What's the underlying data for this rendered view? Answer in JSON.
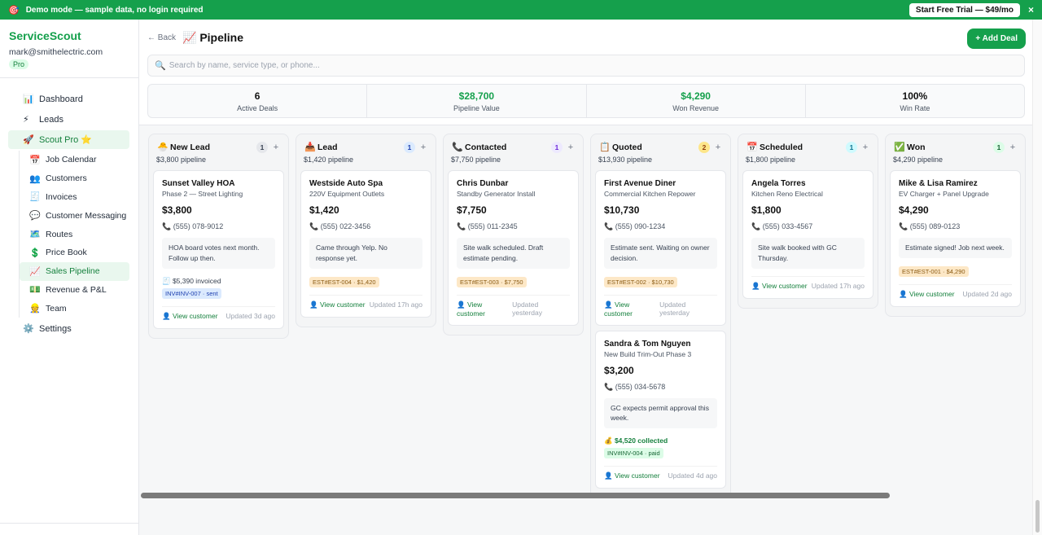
{
  "banner": {
    "icon": "🎯",
    "text": "Demo mode — sample data, no login required",
    "trial_label": "Start Free Trial — $49/mo",
    "close": "×"
  },
  "sidebar": {
    "brand": "ServiceScout",
    "email": "mark@smithelectric.com",
    "plan": "Pro",
    "items": [
      {
        "icon": "📊",
        "label": "Dashboard"
      },
      {
        "icon": "⚡",
        "label": "Leads"
      },
      {
        "icon": "🚀",
        "label": "Scout Pro ⭐"
      }
    ],
    "subitems": [
      {
        "icon": "📅",
        "label": "Job Calendar"
      },
      {
        "icon": "👥",
        "label": "Customers"
      },
      {
        "icon": "🧾",
        "label": "Invoices"
      },
      {
        "icon": "💬",
        "label": "Customer Messaging"
      },
      {
        "icon": "🗺️",
        "label": "Routes"
      },
      {
        "icon": "💲",
        "label": "Price Book"
      },
      {
        "icon": "📈",
        "label": "Sales Pipeline"
      },
      {
        "icon": "💵",
        "label": "Revenue & P&L"
      },
      {
        "icon": "👷",
        "label": "Team"
      }
    ],
    "settings": {
      "icon": "⚙️",
      "label": "Settings"
    }
  },
  "header": {
    "back": "← Back",
    "title": "📈 Pipeline",
    "add_label": "+ Add Deal",
    "search_icon": "🔍",
    "search_placeholder": "Search by name, service type, or phone..."
  },
  "stats": [
    {
      "value": "6",
      "label": "Active Deals",
      "color": "#111111"
    },
    {
      "value": "$28,700",
      "label": "Pipeline Value",
      "color": "#15a04c"
    },
    {
      "value": "$4,290",
      "label": "Won Revenue",
      "color": "#15a04c"
    },
    {
      "value": "100%",
      "label": "Win Rate",
      "color": "#111111"
    }
  ],
  "columns": [
    {
      "icon": "🐣",
      "name": "New Lead",
      "count": "1",
      "count_bg": "#e5e7eb",
      "count_fg": "#374151",
      "pipeline": "$3,800 pipeline",
      "cards": [
        {
          "title": "Sunset Valley HOA",
          "sub": "Phase 2 — Street Lighting",
          "amount": "$3,800",
          "phone": "📞 (555) 078-9012",
          "note": "HOA board votes next month. Follow up then.",
          "invoice": "🧾 $5,390 invoiced",
          "badge": "INV#INV-007 · sent",
          "badge_type": "sent",
          "view": "👤 View customer",
          "updated": "Updated 3d ago"
        }
      ]
    },
    {
      "icon": "📥",
      "name": "Lead",
      "count": "1",
      "count_bg": "#dbeafe",
      "count_fg": "#1e40af",
      "pipeline": "$1,420 pipeline",
      "cards": [
        {
          "title": "Westside Auto Spa",
          "sub": "220V Equipment Outlets",
          "amount": "$1,420",
          "phone": "📞 (555) 022-3456",
          "note": "Came through Yelp. No response yet.",
          "badge": "EST#EST-004 · $1,420",
          "badge_type": "est",
          "view": "👤 View customer",
          "updated": "Updated 17h ago"
        }
      ]
    },
    {
      "icon": "📞",
      "name": "Contacted",
      "count": "1",
      "count_bg": "#ede9fe",
      "count_fg": "#6d28d9",
      "pipeline": "$7,750 pipeline",
      "cards": [
        {
          "title": "Chris Dunbar",
          "sub": "Standby Generator Install",
          "amount": "$7,750",
          "phone": "📞 (555) 011-2345",
          "note": "Site walk scheduled. Draft estimate pending.",
          "badge": "EST#EST-003 · $7,750",
          "badge_type": "est",
          "view": "👤 View customer",
          "updated": "Updated yesterday"
        }
      ]
    },
    {
      "icon": "📋",
      "name": "Quoted",
      "count": "2",
      "count_bg": "#fde68a",
      "count_fg": "#92400e",
      "pipeline": "$13,930 pipeline",
      "cards": [
        {
          "title": "First Avenue Diner",
          "sub": "Commercial Kitchen Repower",
          "amount": "$10,730",
          "phone": "📞 (555) 090-1234",
          "note": "Estimate sent. Waiting on owner decision.",
          "badge": "EST#EST-002 · $10,730",
          "badge_type": "est",
          "view": "👤 View customer",
          "updated": "Updated yesterday"
        },
        {
          "title": "Sandra & Tom Nguyen",
          "sub": "New Build Trim-Out Phase 3",
          "amount": "$3,200",
          "phone": "📞 (555) 034-5678",
          "note": "GC expects permit approval this week.",
          "collected": "💰 $4,520 collected",
          "badge": "INV#INV-004 · paid",
          "badge_type": "paid",
          "view": "👤 View customer",
          "updated": "Updated 4d ago"
        }
      ]
    },
    {
      "icon": "📅",
      "name": "Scheduled",
      "count": "1",
      "count_bg": "#cffafe",
      "count_fg": "#0e7490",
      "pipeline": "$1,800 pipeline",
      "cards": [
        {
          "title": "Angela Torres",
          "sub": "Kitchen Reno Electrical",
          "amount": "$1,800",
          "phone": "📞 (555) 033-4567",
          "note": "Site walk booked with GC Thursday.",
          "view": "👤 View customer",
          "updated": "Updated 17h ago"
        }
      ]
    },
    {
      "icon": "✅",
      "name": "Won",
      "count": "1",
      "count_bg": "#dcfce7",
      "count_fg": "#166534",
      "pipeline": "$4,290 pipeline",
      "cards": [
        {
          "title": "Mike & Lisa Ramirez",
          "sub": "EV Charger + Panel Upgrade",
          "amount": "$4,290",
          "phone": "📞 (555) 089-0123",
          "note": "Estimate signed! Job next week.",
          "badge": "EST#EST-001 · $4,290",
          "badge_type": "est",
          "view": "👤 View customer",
          "updated": "Updated 2d ago"
        }
      ]
    }
  ]
}
